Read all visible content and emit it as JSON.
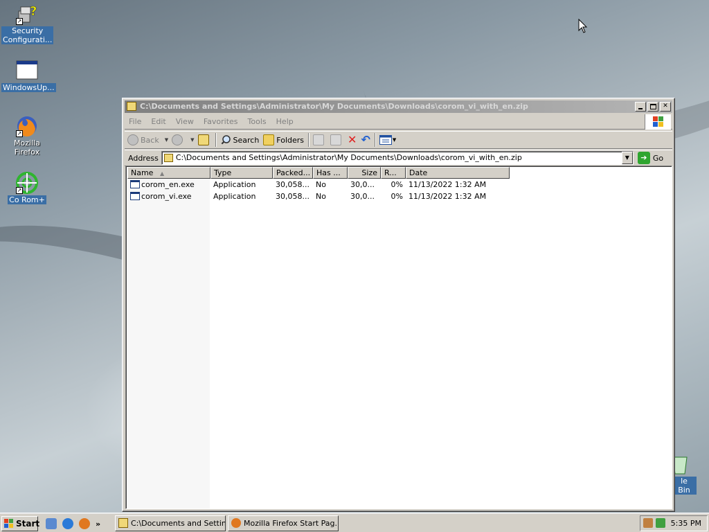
{
  "desktop": {
    "icons": [
      {
        "label": "Security Configurati..."
      },
      {
        "label": "WindowsUp..."
      },
      {
        "label": "Mozilla Firefox"
      },
      {
        "label": "Co Rom+"
      },
      {
        "label": "le Bin"
      }
    ]
  },
  "window": {
    "title": "C:\\Documents and Settings\\Administrator\\My Documents\\Downloads\\corom_vi_with_en.zip",
    "menu": [
      "File",
      "Edit",
      "View",
      "Favorites",
      "Tools",
      "Help"
    ],
    "toolbar": {
      "back_label": "Back",
      "search_label": "Search",
      "folders_label": "Folders"
    },
    "address": {
      "label": "Address",
      "value": "C:\\Documents and Settings\\Administrator\\My Documents\\Downloads\\corom_vi_with_en.zip",
      "go_label": "Go"
    },
    "columns": [
      "Name",
      "Type",
      "Packed...",
      "Has ...",
      "Size",
      "R...",
      "Date"
    ],
    "rows": [
      {
        "name": "corom_en.exe",
        "type": "Application",
        "packed": "30,058...",
        "has": "No",
        "size": "30,0...",
        "ratio": "0%",
        "date": "11/13/2022 1:32 AM"
      },
      {
        "name": "corom_vi.exe",
        "type": "Application",
        "packed": "30,058...",
        "has": "No",
        "size": "30,0...",
        "ratio": "0%",
        "date": "11/13/2022 1:32 AM"
      }
    ]
  },
  "taskbar": {
    "start_label": "Start",
    "quicklaunch_more": "»",
    "tasks": [
      {
        "label": "C:\\Documents and Settin..."
      },
      {
        "label": "Mozilla Firefox Start Pag..."
      }
    ],
    "clock": "5:35 PM"
  }
}
